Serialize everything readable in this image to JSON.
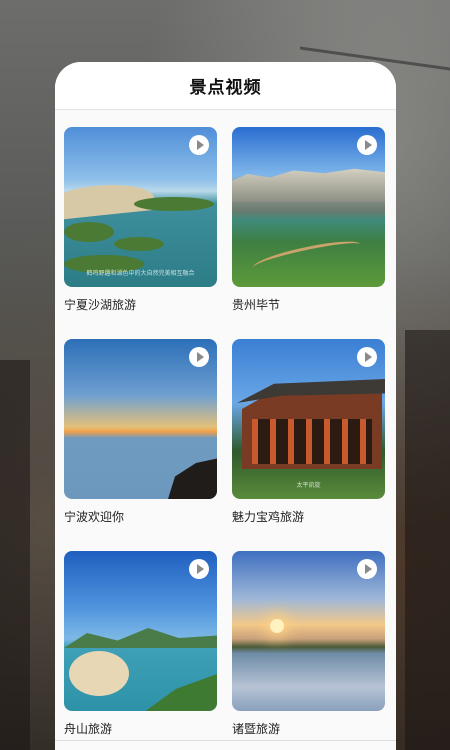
{
  "page": {
    "title": "景点视频"
  },
  "videos": [
    {
      "label": "宁夏沙湖旅游",
      "caption": "鹤鸣野趣和湖色中的大自然完美相互融合"
    },
    {
      "label": "贵州毕节",
      "caption": ""
    },
    {
      "label": "宁波欢迎你",
      "caption": ""
    },
    {
      "label": "魅力宝鸡旅游",
      "caption": "太平凯旋"
    },
    {
      "label": "舟山旅游",
      "caption": ""
    },
    {
      "label": "诸暨旅游",
      "caption": ""
    }
  ],
  "icons": {
    "play": "play-icon"
  }
}
